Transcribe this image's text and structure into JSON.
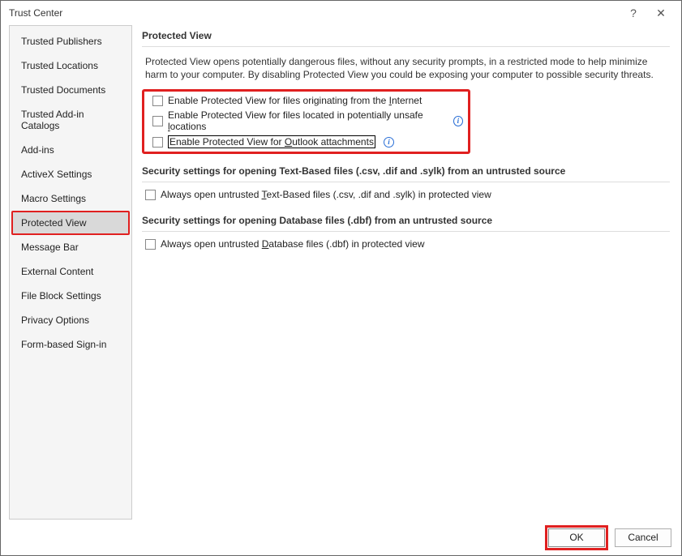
{
  "titlebar": {
    "title": "Trust Center",
    "help": "?",
    "close": "✕"
  },
  "sidebar": {
    "items": [
      {
        "label": "Trusted Publishers"
      },
      {
        "label": "Trusted Locations"
      },
      {
        "label": "Trusted Documents"
      },
      {
        "label": "Trusted Add-in Catalogs"
      },
      {
        "label": "Add-ins"
      },
      {
        "label": "ActiveX Settings"
      },
      {
        "label": "Macro Settings"
      },
      {
        "label": "Protected View",
        "selected": true
      },
      {
        "label": "Message Bar"
      },
      {
        "label": "External Content"
      },
      {
        "label": "File Block Settings"
      },
      {
        "label": "Privacy Options"
      },
      {
        "label": "Form-based Sign-in"
      }
    ]
  },
  "sections": {
    "protected_view": {
      "heading": "Protected View",
      "description": "Protected View opens potentially dangerous files, without any security prompts, in a restricted mode to help minimize harm to your computer. By disabling Protected View you could be exposing your computer to possible security threats.",
      "checkboxes": [
        {
          "pre": "Enable Protected View for files originating from the ",
          "key": "I",
          "post": "nternet"
        },
        {
          "pre": "Enable Protected View for files located in potentially unsafe ",
          "key": "l",
          "post": "ocations",
          "info": true
        },
        {
          "pre": "Enable Protected View for ",
          "key": "O",
          "post": "utlook attachments",
          "focus": true,
          "info": true
        }
      ]
    },
    "text_based": {
      "heading": "Security settings for opening Text-Based files (.csv, .dif and .sylk) from an untrusted source",
      "checkbox": {
        "pre": "Always open untrusted ",
        "key": "T",
        "post": "ext-Based files (.csv, .dif and .sylk) in protected view"
      }
    },
    "database": {
      "heading": "Security settings for opening Database files (.dbf) from an untrusted source",
      "checkbox": {
        "pre": "Always open untrusted ",
        "key": "D",
        "post": "atabase files (.dbf) in protected view"
      }
    }
  },
  "footer": {
    "ok": "OK",
    "cancel": "Cancel"
  }
}
